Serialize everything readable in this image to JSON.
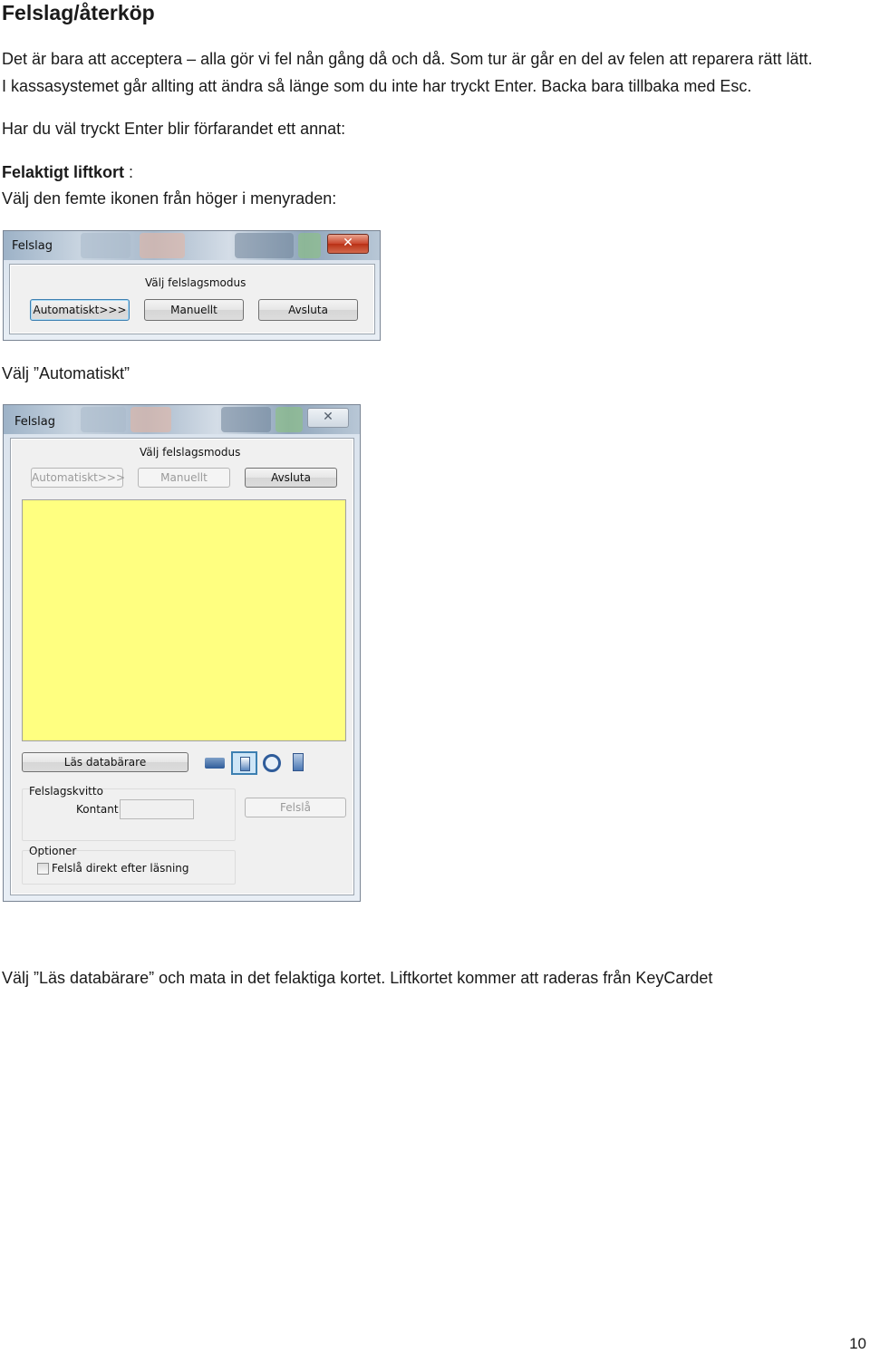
{
  "heading": "Felslag/återköp",
  "paragraphs": {
    "p1_line1": "Det är bara att acceptera – alla gör vi fel nån gång då och då. Som tur är går en del av felen att reparera rätt lätt.",
    "p1_line2": "I kassasystemet går allting att ändra så länge som du inte har tryckt Enter. Backa bara tillbaka med Esc.",
    "p2": "Har du väl tryckt Enter blir förfarandet ett annat:",
    "p3_bold": "Felaktigt liftkort",
    "p3_rest": " :",
    "p4": "Välj den femte ikonen från höger i menyraden:",
    "p5": "Välj ”Automatiskt”",
    "p6": "Välj ”Läs databärare” och mata in det felaktiga kortet. Liftkortet kommer att raderas från KeyCardet"
  },
  "dialog1": {
    "title": "Felslag",
    "close": "✕",
    "mode_label": "Välj felslagsmodus",
    "buttons": [
      "Automatiskt>>>",
      "Manuellt",
      "Avsluta"
    ]
  },
  "dialog2": {
    "title": "Felslag",
    "close": "✕",
    "mode_label": "Välj felslagsmodus",
    "buttons": [
      "Automatiskt>>>",
      "Manuellt",
      "Avsluta"
    ],
    "read_button": "Läs databärare",
    "receipt_group": "Felslagskvitto",
    "cash_label": "Kontant",
    "felsla_button": "Felslå",
    "options_group": "Optioner",
    "option_checkbox": "Felslå direkt efter läsning",
    "yellow_color": "#ffff80",
    "toolbar_icons": [
      "card-icon",
      "card-selected-icon",
      "clock-icon",
      "phone-icon"
    ]
  },
  "page_number": "10"
}
